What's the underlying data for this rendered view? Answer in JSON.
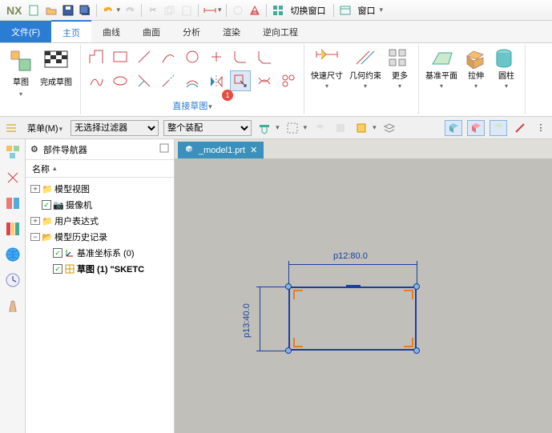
{
  "app": {
    "name": "NX"
  },
  "titlebar": {
    "switch_window": "切换窗口",
    "window": "窗口"
  },
  "menu": {
    "file": "文件(F)",
    "home": "主页",
    "curve": "曲线",
    "surface": "曲面",
    "analysis": "分析",
    "render": "渲染",
    "reverse": "逆向工程"
  },
  "ribbon": {
    "sketch": "草图",
    "finish_sketch": "完成草图",
    "direct_sketch": "直接草图",
    "quick_dim": "快速尺寸",
    "geo_constraint": "几何约束",
    "more": "更多",
    "datum_plane": "基准平面",
    "extrude": "拉伸",
    "cylinder": "圆柱"
  },
  "filterbar": {
    "menu_btn": "菜单(M)",
    "no_filter": "无选择过滤器",
    "assembly": "整个装配"
  },
  "nav": {
    "title": "部件导航器",
    "col_name": "名称",
    "tree": {
      "model_view": "模型视图",
      "camera": "摄像机",
      "user_expr": "用户表达式",
      "history": "模型历史记录",
      "datum_csys": "基准坐标系 (0)",
      "sketch": "草图 (1) \"SKETC"
    }
  },
  "document": {
    "tab": "_model1.prt"
  },
  "sketch": {
    "dim_top": "p12:80.0",
    "dim_left": "p13:40.0"
  },
  "badge": {
    "num": "1"
  }
}
